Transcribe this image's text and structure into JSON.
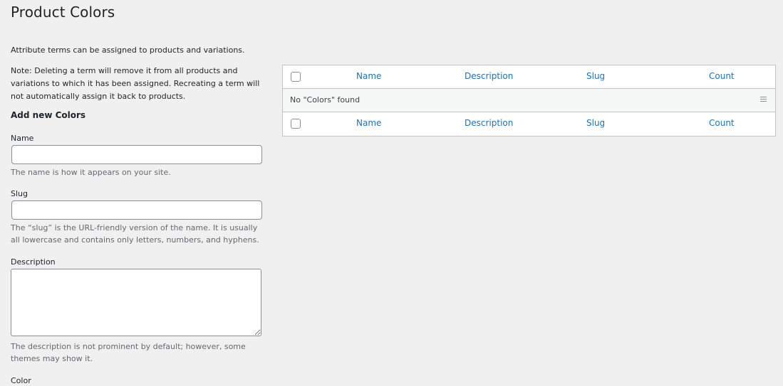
{
  "page": {
    "title": "Product Colors"
  },
  "intro": {
    "text": "Attribute terms can be assigned to products and variations.",
    "note": "Note: Deleting a term will remove it from all products and variations to which it has been assigned. Recreating a term will not automatically assign it back to products."
  },
  "form": {
    "title": "Add new Colors",
    "name": {
      "label": "Name",
      "value": "",
      "help": "The name is how it appears on your site."
    },
    "slug": {
      "label": "Slug",
      "value": "",
      "help": "The “slug” is the URL-friendly version of the name. It is usually all lowercase and contains only letters, numbers, and hyphens."
    },
    "description": {
      "label": "Description",
      "value": "",
      "help": "The description is not prominent by default; however, some themes may show it."
    },
    "color": {
      "label": "Color"
    }
  },
  "table": {
    "columns": [
      "Name",
      "Description",
      "Slug",
      "Count"
    ],
    "empty_message": "No \"Colors\" found",
    "row_menu_icon": "menu-icon"
  }
}
